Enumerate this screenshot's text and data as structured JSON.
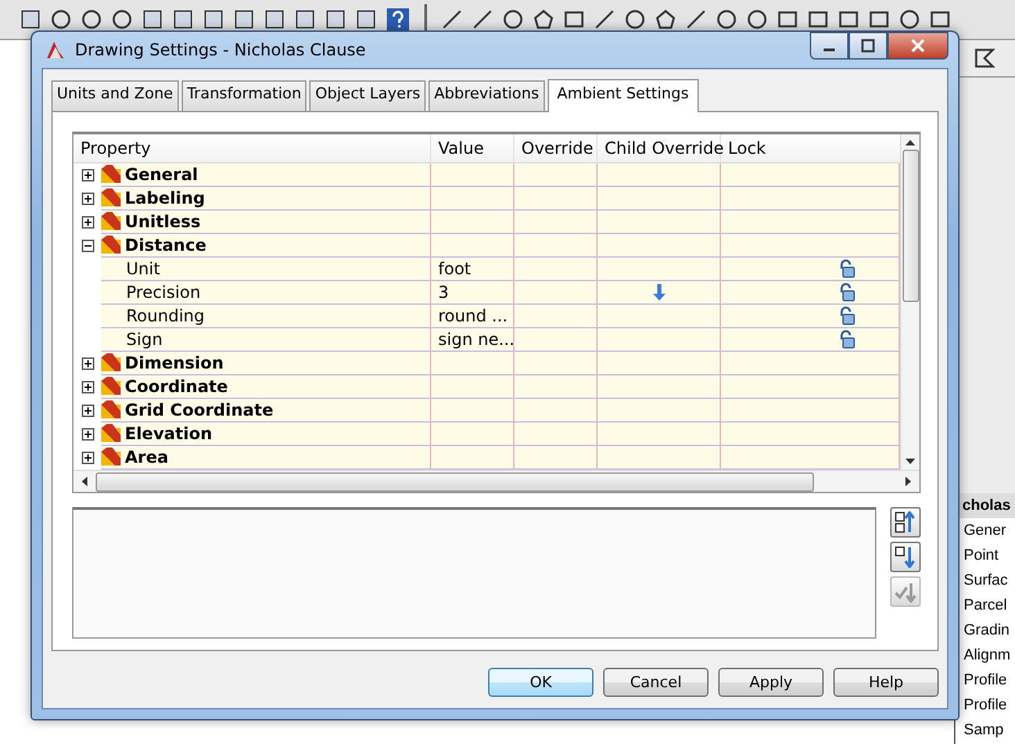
{
  "window": {
    "title": "Drawing Settings - Nicholas Clause"
  },
  "tabs": [
    {
      "label": "Units and Zone",
      "selected": false
    },
    {
      "label": "Transformation",
      "selected": false
    },
    {
      "label": "Object Layers",
      "selected": false
    },
    {
      "label": "Abbreviations",
      "selected": false
    },
    {
      "label": "Ambient Settings",
      "selected": true
    }
  ],
  "table": {
    "columns": [
      "Property",
      "Value",
      "Override",
      "Child Override",
      "Lock"
    ],
    "rows": [
      {
        "kind": "category",
        "label": "General",
        "expanded": false
      },
      {
        "kind": "category",
        "label": "Labeling",
        "expanded": false
      },
      {
        "kind": "category",
        "label": "Unitless",
        "expanded": false
      },
      {
        "kind": "category",
        "label": "Distance",
        "expanded": true
      },
      {
        "kind": "property",
        "label": "Unit",
        "value": "foot",
        "child_override": false,
        "lock": true
      },
      {
        "kind": "property",
        "label": "Precision",
        "value": "3",
        "child_override": true,
        "lock": true
      },
      {
        "kind": "property",
        "label": "Rounding",
        "value": "round ...",
        "child_override": false,
        "lock": true
      },
      {
        "kind": "property",
        "label": "Sign",
        "value": "sign ne...",
        "child_override": false,
        "lock": true
      },
      {
        "kind": "category",
        "label": "Dimension",
        "expanded": false
      },
      {
        "kind": "category",
        "label": "Coordinate",
        "expanded": false
      },
      {
        "kind": "category",
        "label": "Grid Coordinate",
        "expanded": false
      },
      {
        "kind": "category",
        "label": "Elevation",
        "expanded": false
      },
      {
        "kind": "category",
        "label": "Area",
        "expanded": false
      }
    ]
  },
  "side_buttons": [
    {
      "kind": "expand",
      "disabled": false
    },
    {
      "kind": "collapse",
      "disabled": false
    },
    {
      "kind": "check",
      "disabled": true
    }
  ],
  "buttons": [
    {
      "label": "OK",
      "default": true
    },
    {
      "label": "Cancel",
      "default": false
    },
    {
      "label": "Apply",
      "default": false
    },
    {
      "label": "Help",
      "default": false
    }
  ],
  "background_panel": {
    "title": "cholas",
    "items": [
      "Gener",
      "Point",
      "Surfac",
      "Parcel",
      "Gradin",
      "Alignm",
      "Profile",
      "Profile",
      "Samp"
    ]
  }
}
